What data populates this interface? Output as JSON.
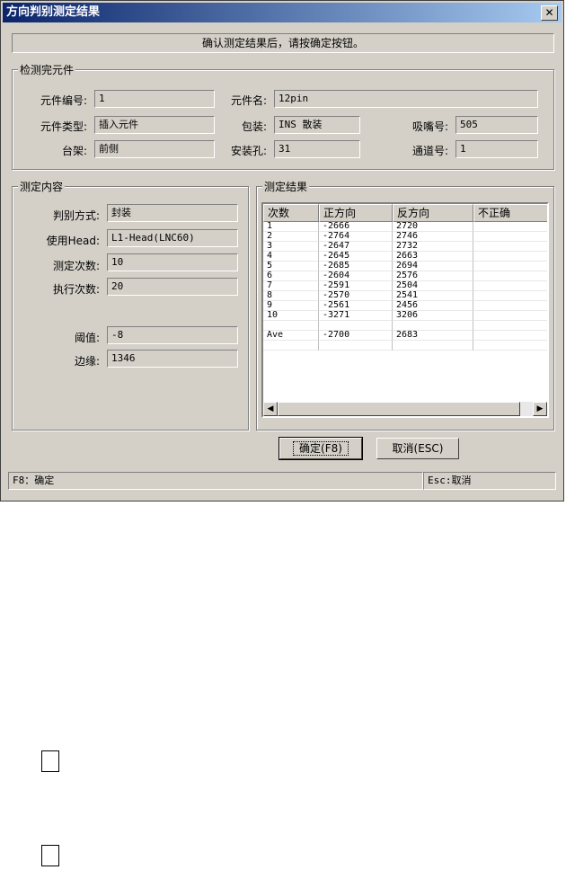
{
  "window": {
    "title": "方向判别测定结果",
    "close": "✕"
  },
  "message": "确认测定结果后，请按确定按钮。",
  "component_group": {
    "title": "检测完元件",
    "fields": [
      {
        "label": "元件编号:",
        "value": "1"
      },
      {
        "label": "元件名:",
        "value": "12pin"
      },
      {
        "label": "元件类型:",
        "value": "插入元件"
      },
      {
        "label": "包装:",
        "value": "INS 散装"
      },
      {
        "label": "吸嘴号:",
        "value": "505"
      },
      {
        "label": "台架:",
        "value": "前侧"
      },
      {
        "label": "安装孔:",
        "value": "31"
      },
      {
        "label": "通道号:",
        "value": "1"
      }
    ]
  },
  "measure_group": {
    "title": "测定内容",
    "fields": [
      {
        "label": "判别方式:",
        "value": "封装"
      },
      {
        "label": "使用Head:",
        "value": "L1-Head(LNC60)"
      },
      {
        "label": "测定次数:",
        "value": "10"
      },
      {
        "label": "执行次数:",
        "value": "20"
      },
      {
        "label": "阈值:",
        "value": "-8"
      },
      {
        "label": "边缘:",
        "value": "1346"
      }
    ]
  },
  "result_group": {
    "title": "测定结果",
    "columns": [
      "次数",
      "正方向",
      "反方向",
      "不正确"
    ],
    "rows": [
      [
        "1",
        "-2666",
        "2720",
        ""
      ],
      [
        "2",
        "-2764",
        "2746",
        ""
      ],
      [
        "3",
        "-2647",
        "2732",
        ""
      ],
      [
        "4",
        "-2645",
        "2663",
        ""
      ],
      [
        "5",
        "-2685",
        "2694",
        ""
      ],
      [
        "6",
        "-2604",
        "2576",
        ""
      ],
      [
        "7",
        "-2591",
        "2504",
        ""
      ],
      [
        "8",
        "-2570",
        "2541",
        ""
      ],
      [
        "9",
        "-2561",
        "2456",
        ""
      ],
      [
        "10",
        "-3271",
        "3206",
        ""
      ],
      [
        "",
        "",
        "",
        ""
      ],
      [
        "Ave",
        "-2700",
        "2683",
        ""
      ],
      [
        "",
        "",
        "",
        ""
      ]
    ],
    "scroll_left": "◀",
    "scroll_right": "▶"
  },
  "buttons": {
    "ok": "确定(F8)",
    "cancel": "取消(ESC)"
  },
  "statusbar": {
    "left": "F8：确定",
    "right": "Esc:取消"
  }
}
